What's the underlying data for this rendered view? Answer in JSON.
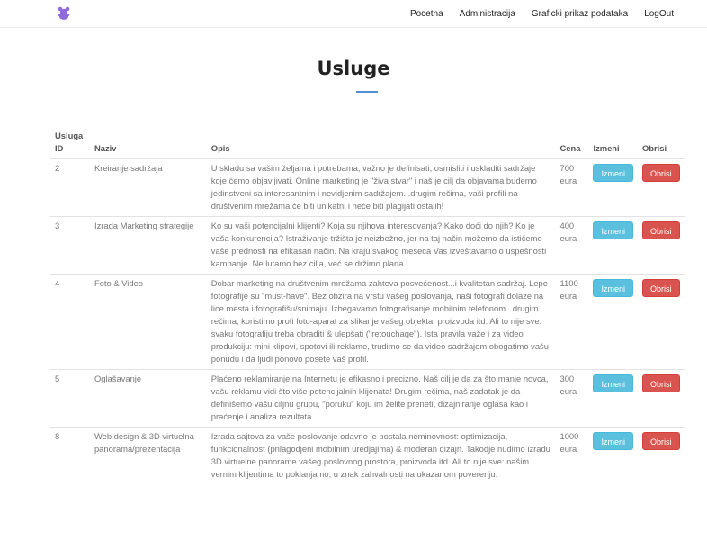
{
  "nav": {
    "links": [
      "Pocetna",
      "Administracija",
      "Graficki prikaz podataka",
      "LogOut"
    ],
    "logo_color": "#8e6bd6"
  },
  "page": {
    "title": "Usluge",
    "underline_color": "#4d8fd0"
  },
  "table": {
    "headers": {
      "id": "Usluga ID",
      "name": "Naziv",
      "desc": "Opis",
      "price": "Cena",
      "edit": "Izmeni",
      "del": "Obrisi"
    },
    "rows": [
      {
        "id": "2",
        "name": "Kreiranje sadržaja",
        "desc": "U skladu sa vašim željama i potrebama, važno je definisati, osmisliti i uskladiti sadržaje koje ćemo objavljivati. Online marketing je \"živa stvar\" i naš je cilj da objavama budemo jedinstveni sa interesantnim i nevidjenim sadržajem...drugim rečima, vaši profili na društvenim mrežama će biti unikatni i neće biti plagijati ostalih!",
        "price": "700 eura",
        "edit_label": "Izmeni",
        "del_label": "Obrisi"
      },
      {
        "id": "3",
        "name": "Izrada Marketing strategije",
        "desc": "Ko su vaši potencijalni klijenti? Koja su njihova interesovanja? Kako doći do njih? Ko je vaša konkurencija? Istraživanje tržišta je neizbežno, jer na taj način možemo da ističemo vaše prednosti na efikasan način. Na kraju svakog meseca Vas izveštavamo o uspešnosti kampanje. Ne lutamo bez cilja, već se držimo plana !",
        "price": "400 eura",
        "edit_label": "Izmeni",
        "del_label": "Obrisi"
      },
      {
        "id": "4",
        "name": "Foto & Video",
        "desc": "Dobar marketing na društvenim mrežama zahteva posvećenost...i kvalitetan sadržaj. Lepe fotografije su \"must-have\". Bez obzira na vrstu vašeg poslovanja, naši fotografi dolaze na lice mesta i fotografišu/snimaju. Izbegavamo fotografisanje mobilnim telefonom...drugim rečima, koristimo profi foto-aparat za slikanje vašeg objekta, proizvoda itd. Ali to nije sve: svaku fotografiju treba obraditi & ulepšati (\"retouchage\"). Ista pravila važe i za video produkciju: mini klipovi, spotovi ili reklame, trudimo se da video sadržajem obogatimo vašu ponudu i da ljudi ponovo posete vaš profil.",
        "price": "1100 eura",
        "edit_label": "Izmeni",
        "del_label": "Obrisi"
      },
      {
        "id": "5",
        "name": "Oglašavanje",
        "desc": "Plaćeno reklamiranje na Internetu je efikasno i precizno. Naš cilj je da za što manje novca, vašu reklamu vidi što više potencijalnih klijenata! Drugim rečima, naš zadatak je da definišemo vašu ciljnu grupu, \"poruku\" koju im želite preneti, dizajniranje oglasa kao i praćenje i analiza rezultata.",
        "price": "300 eura",
        "edit_label": "Izmeni",
        "del_label": "Obrisi"
      },
      {
        "id": "8",
        "name": "Web design & 3D virtuelna panorama/prezentacija",
        "desc": "Izrada sajtova za vaše poslovanje odavno je postala neminovnost: optimizacija, funkcionalnost (prilagodjeni mobilnim uredjajima) & moderan dizajn. Takodje nudimo izradu 3D virtuelne panorame vašeg poslovnog prostora, proizvoda itd. Ali to nije sve: našim vernim klijentima to poklanjamo, u znak zahvalnosti na ukazanom poverenju.",
        "price": "1000 eura",
        "edit_label": "Izmeni",
        "del_label": "Obrisi"
      }
    ]
  }
}
